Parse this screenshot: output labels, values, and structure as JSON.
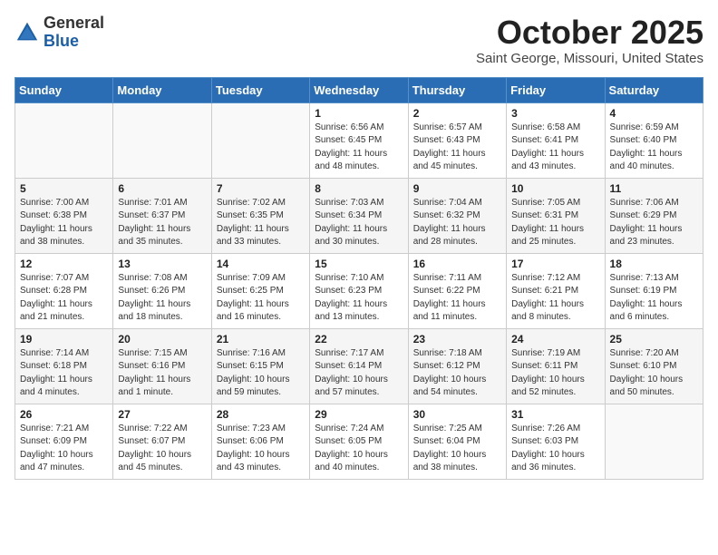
{
  "header": {
    "logo_general": "General",
    "logo_blue": "Blue",
    "title": "October 2025",
    "subtitle": "Saint George, Missouri, United States"
  },
  "weekdays": [
    "Sunday",
    "Monday",
    "Tuesday",
    "Wednesday",
    "Thursday",
    "Friday",
    "Saturday"
  ],
  "weeks": [
    [
      {
        "day": "",
        "info": ""
      },
      {
        "day": "",
        "info": ""
      },
      {
        "day": "",
        "info": ""
      },
      {
        "day": "1",
        "info": "Sunrise: 6:56 AM\nSunset: 6:45 PM\nDaylight: 11 hours\nand 48 minutes."
      },
      {
        "day": "2",
        "info": "Sunrise: 6:57 AM\nSunset: 6:43 PM\nDaylight: 11 hours\nand 45 minutes."
      },
      {
        "day": "3",
        "info": "Sunrise: 6:58 AM\nSunset: 6:41 PM\nDaylight: 11 hours\nand 43 minutes."
      },
      {
        "day": "4",
        "info": "Sunrise: 6:59 AM\nSunset: 6:40 PM\nDaylight: 11 hours\nand 40 minutes."
      }
    ],
    [
      {
        "day": "5",
        "info": "Sunrise: 7:00 AM\nSunset: 6:38 PM\nDaylight: 11 hours\nand 38 minutes."
      },
      {
        "day": "6",
        "info": "Sunrise: 7:01 AM\nSunset: 6:37 PM\nDaylight: 11 hours\nand 35 minutes."
      },
      {
        "day": "7",
        "info": "Sunrise: 7:02 AM\nSunset: 6:35 PM\nDaylight: 11 hours\nand 33 minutes."
      },
      {
        "day": "8",
        "info": "Sunrise: 7:03 AM\nSunset: 6:34 PM\nDaylight: 11 hours\nand 30 minutes."
      },
      {
        "day": "9",
        "info": "Sunrise: 7:04 AM\nSunset: 6:32 PM\nDaylight: 11 hours\nand 28 minutes."
      },
      {
        "day": "10",
        "info": "Sunrise: 7:05 AM\nSunset: 6:31 PM\nDaylight: 11 hours\nand 25 minutes."
      },
      {
        "day": "11",
        "info": "Sunrise: 7:06 AM\nSunset: 6:29 PM\nDaylight: 11 hours\nand 23 minutes."
      }
    ],
    [
      {
        "day": "12",
        "info": "Sunrise: 7:07 AM\nSunset: 6:28 PM\nDaylight: 11 hours\nand 21 minutes."
      },
      {
        "day": "13",
        "info": "Sunrise: 7:08 AM\nSunset: 6:26 PM\nDaylight: 11 hours\nand 18 minutes."
      },
      {
        "day": "14",
        "info": "Sunrise: 7:09 AM\nSunset: 6:25 PM\nDaylight: 11 hours\nand 16 minutes."
      },
      {
        "day": "15",
        "info": "Sunrise: 7:10 AM\nSunset: 6:23 PM\nDaylight: 11 hours\nand 13 minutes."
      },
      {
        "day": "16",
        "info": "Sunrise: 7:11 AM\nSunset: 6:22 PM\nDaylight: 11 hours\nand 11 minutes."
      },
      {
        "day": "17",
        "info": "Sunrise: 7:12 AM\nSunset: 6:21 PM\nDaylight: 11 hours\nand 8 minutes."
      },
      {
        "day": "18",
        "info": "Sunrise: 7:13 AM\nSunset: 6:19 PM\nDaylight: 11 hours\nand 6 minutes."
      }
    ],
    [
      {
        "day": "19",
        "info": "Sunrise: 7:14 AM\nSunset: 6:18 PM\nDaylight: 11 hours\nand 4 minutes."
      },
      {
        "day": "20",
        "info": "Sunrise: 7:15 AM\nSunset: 6:16 PM\nDaylight: 11 hours\nand 1 minute."
      },
      {
        "day": "21",
        "info": "Sunrise: 7:16 AM\nSunset: 6:15 PM\nDaylight: 10 hours\nand 59 minutes."
      },
      {
        "day": "22",
        "info": "Sunrise: 7:17 AM\nSunset: 6:14 PM\nDaylight: 10 hours\nand 57 minutes."
      },
      {
        "day": "23",
        "info": "Sunrise: 7:18 AM\nSunset: 6:12 PM\nDaylight: 10 hours\nand 54 minutes."
      },
      {
        "day": "24",
        "info": "Sunrise: 7:19 AM\nSunset: 6:11 PM\nDaylight: 10 hours\nand 52 minutes."
      },
      {
        "day": "25",
        "info": "Sunrise: 7:20 AM\nSunset: 6:10 PM\nDaylight: 10 hours\nand 50 minutes."
      }
    ],
    [
      {
        "day": "26",
        "info": "Sunrise: 7:21 AM\nSunset: 6:09 PM\nDaylight: 10 hours\nand 47 minutes."
      },
      {
        "day": "27",
        "info": "Sunrise: 7:22 AM\nSunset: 6:07 PM\nDaylight: 10 hours\nand 45 minutes."
      },
      {
        "day": "28",
        "info": "Sunrise: 7:23 AM\nSunset: 6:06 PM\nDaylight: 10 hours\nand 43 minutes."
      },
      {
        "day": "29",
        "info": "Sunrise: 7:24 AM\nSunset: 6:05 PM\nDaylight: 10 hours\nand 40 minutes."
      },
      {
        "day": "30",
        "info": "Sunrise: 7:25 AM\nSunset: 6:04 PM\nDaylight: 10 hours\nand 38 minutes."
      },
      {
        "day": "31",
        "info": "Sunrise: 7:26 AM\nSunset: 6:03 PM\nDaylight: 10 hours\nand 36 minutes."
      },
      {
        "day": "",
        "info": ""
      }
    ]
  ]
}
